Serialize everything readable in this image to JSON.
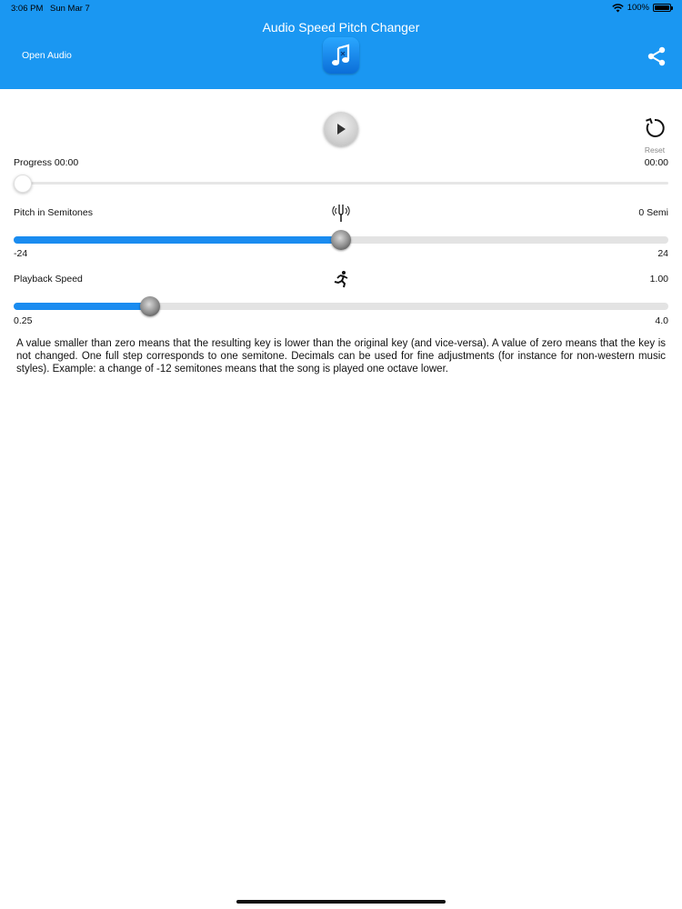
{
  "status_bar": {
    "time": "3:06 PM",
    "date": "Sun Mar 7",
    "battery": "100%",
    "icons": [
      "wifi-icon",
      "battery-icon"
    ]
  },
  "header": {
    "title": "Audio Speed Pitch Changer",
    "open_audio": "Open Audio",
    "icons": [
      "app-music-icon",
      "share-icon"
    ],
    "accent_color": "#1a97f2"
  },
  "controls": {
    "play_icon": "play-icon",
    "reset_label": "Reset",
    "reset_icon": "reset-icon"
  },
  "progress": {
    "label": "Progress 00:00",
    "time_right": "00:00",
    "value": 0
  },
  "pitch": {
    "label": "Pitch in Semitones",
    "value_text": "0 Semi",
    "min": "-24",
    "max": "24",
    "value": 0,
    "icon": "tuning-fork-icon"
  },
  "speed": {
    "label": "Playback Speed",
    "value_text": "1.00",
    "min": "0.25",
    "max": "4.0",
    "value": 1.0,
    "icon": "running-icon"
  },
  "description": "A value smaller than zero means that the resulting key is lower than the original key (and vice-versa). A value of zero means that the key is not changed. One full step corresponds to one semitone. Decimals can be used for fine adjustments (for instance for non-western music styles). Example: a change of -12 semitones means that the song is played one octave lower."
}
